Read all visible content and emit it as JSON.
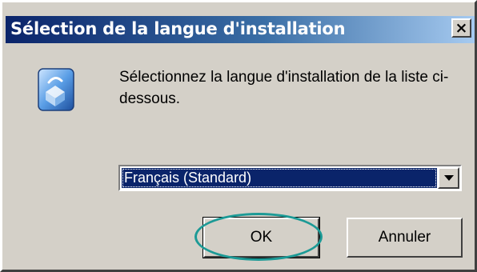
{
  "dialog": {
    "title": "Sélection de la langue d'installation",
    "close_label": "×",
    "app_icon": "installer-package-icon",
    "message": "Sélectionnez la langue d'installation de la liste ci-dessous.",
    "language_select": {
      "selected": "Français (Standard)"
    },
    "ok_label": "OK",
    "cancel_label": "Annuler"
  },
  "colors": {
    "title_gradient_start": "#0a246a",
    "title_gradient_end": "#a6caf0",
    "window_face": "#d4d0c8",
    "selection": "#0a246a",
    "highlight_annotation": "#1c9a96"
  }
}
